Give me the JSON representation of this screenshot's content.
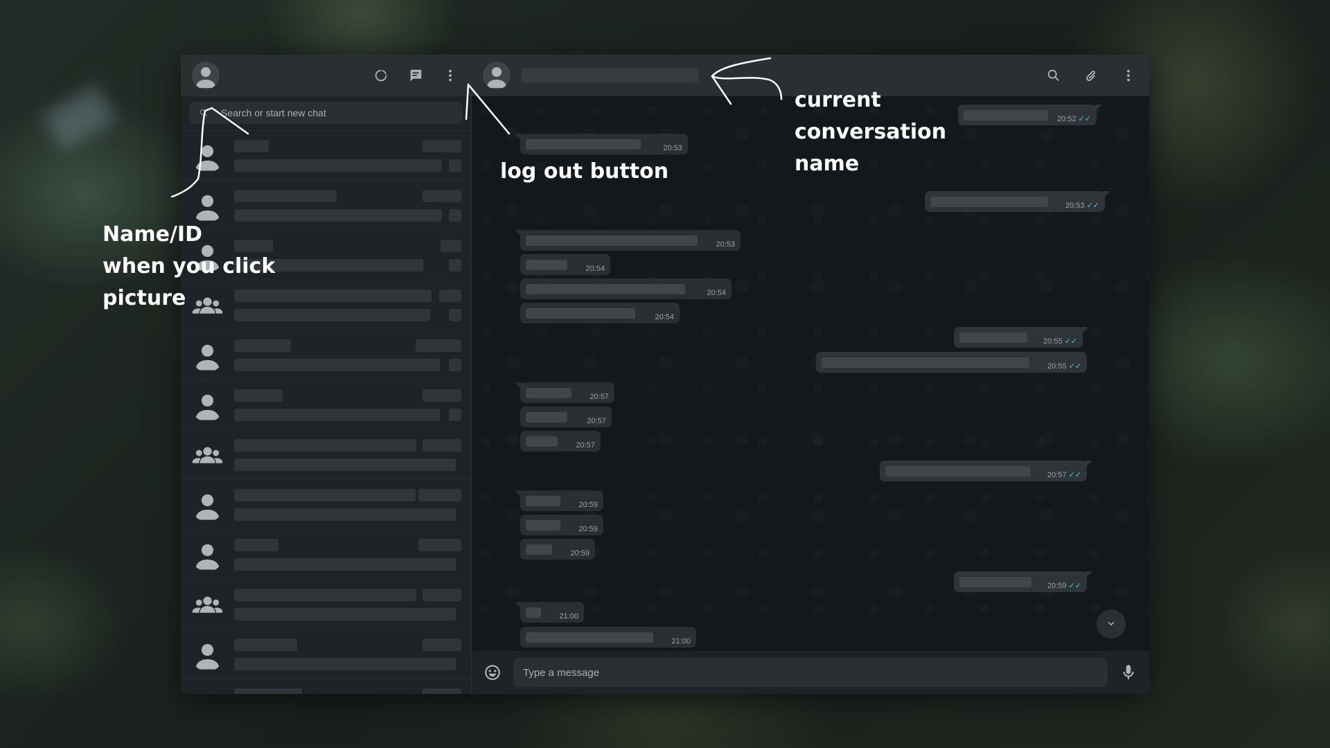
{
  "search": {
    "placeholder": "Search or start new chat"
  },
  "composer": {
    "placeholder": "Type a message"
  },
  "annotations": {
    "name_id": "Name/ID\nwhen you click\npicture",
    "logout": "log out button",
    "conversation": "current\nconversation\nname"
  },
  "chats": [
    {
      "type": "person"
    },
    {
      "type": "person"
    },
    {
      "type": "person"
    },
    {
      "type": "group"
    },
    {
      "type": "person"
    },
    {
      "type": "person"
    },
    {
      "type": "group"
    },
    {
      "type": "person"
    },
    {
      "type": "person"
    },
    {
      "type": "group"
    },
    {
      "type": "person"
    },
    {
      "type": "person"
    }
  ],
  "messages": [
    {
      "dir": "out",
      "time": "20:52",
      "read": true
    },
    {
      "dir": "in",
      "time": "20:53"
    },
    {
      "dir": "out",
      "time": "20:53",
      "read": true
    },
    {
      "dir": "in",
      "time": "20:53"
    },
    {
      "dir": "in",
      "time": "20:54"
    },
    {
      "dir": "in",
      "time": "20:54"
    },
    {
      "dir": "in",
      "time": "20:54"
    },
    {
      "dir": "out",
      "time": "20:55",
      "read": true
    },
    {
      "dir": "out",
      "time": "20:55",
      "read": true
    },
    {
      "dir": "in",
      "time": "20:57"
    },
    {
      "dir": "in",
      "time": "20:57"
    },
    {
      "dir": "in",
      "time": "20:57"
    },
    {
      "dir": "out",
      "time": "20:57",
      "read": true
    },
    {
      "dir": "in",
      "time": "20:59"
    },
    {
      "dir": "in",
      "time": "20:59"
    },
    {
      "dir": "in",
      "time": "20:59"
    },
    {
      "dir": "out",
      "time": "20:59",
      "read": true
    },
    {
      "dir": "in",
      "time": "21:00"
    },
    {
      "dir": "in",
      "time": "21:00"
    }
  ],
  "colors": {
    "read_ticks": "#53bdeb",
    "annotation": "#ffffff"
  },
  "icons": [
    "user-avatar-icon",
    "status-icon",
    "new-chat-icon",
    "menu-icon",
    "search-icon",
    "attach-icon",
    "emoji-icon",
    "mic-icon",
    "chevron-down-icon",
    "group-avatar-icon"
  ]
}
